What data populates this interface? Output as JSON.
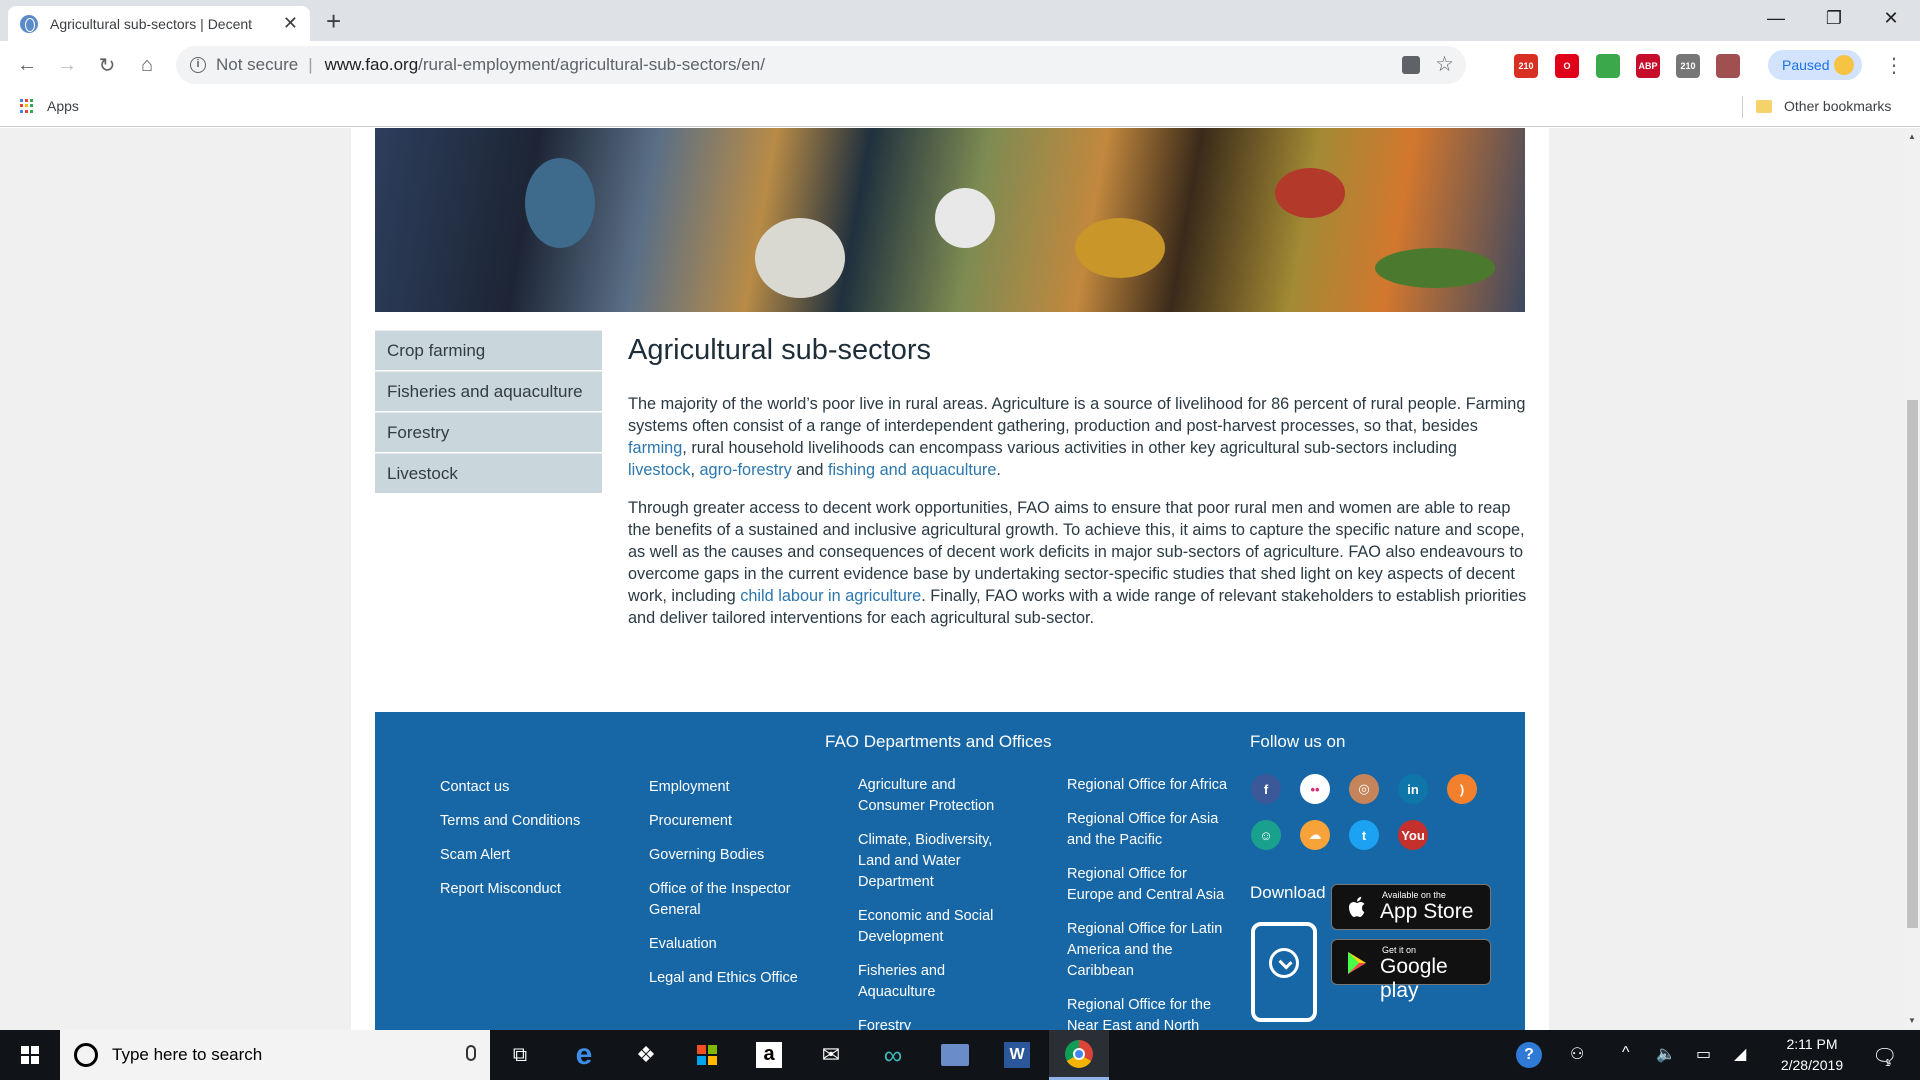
{
  "browser": {
    "tab_title": "Agricultural sub-sectors | Decent",
    "new_tab": "+",
    "security_label": "Not secure",
    "url_host": "www.fao.org",
    "url_path": "/rural-employment/agricultural-sub-sectors/en/",
    "profile_label": "Paused",
    "extensions": [
      {
        "name": "gmail-extension-icon",
        "text": "210",
        "color": "#d93025"
      },
      {
        "name": "opera-extension-icon",
        "text": "O",
        "color": "#e0001a"
      },
      {
        "name": "globe-extension-icon",
        "text": "",
        "color": "#3aa84b"
      },
      {
        "name": "adblock-extension-icon",
        "text": "ABP",
        "color": "#c70d2c"
      },
      {
        "name": "gmail-extension-icon-2",
        "text": "210",
        "color": "#777777"
      },
      {
        "name": "pdf-extension-icon",
        "text": "",
        "color": "#a05050"
      }
    ],
    "bookmarks": {
      "apps": "Apps",
      "other": "Other bookmarks"
    }
  },
  "sidenav": {
    "items": [
      "Crop farming",
      "Fisheries and aquaculture",
      "Forestry",
      "Livestock"
    ]
  },
  "content": {
    "title": "Agricultural sub-sectors",
    "p1_a": "The majority of the world’s poor live in rural areas. Agriculture is a source of livelihood for 86 percent of rural people. Farming systems often consist of a range of interdependent gathering, production and post-harvest processes, so that, besides ",
    "p1_link1": "farming",
    "p1_b": ", rural household livelihoods can encompass various activities in other key agricultural sub-sectors including ",
    "p1_link2": "livestock",
    "p1_c": ", ",
    "p1_link3": "agro-forestry",
    "p1_d": " and ",
    "p1_link4": "fishing and aquaculture",
    "p1_e": ".",
    "p2_a": "Through greater access to decent work opportunities, FAO aims to ensure that poor rural men and women are able to reap the benefits of a sustained and inclusive agricultural growth. To achieve this, it aims to capture the specific nature and scope, as well as the causes and consequences of decent work deficits in major sub-sectors of agriculture. FAO also endeavours to overcome gaps in the current evidence base by undertaking sector-specific studies that shed light on key aspects of decent work, including ",
    "p2_link": "child labour in agriculture",
    "p2_b": ". Finally, FAO works with a wide range of relevant stakeholders to establish priorities and deliver tailored interventions for each agricultural sub-sector."
  },
  "footer": {
    "dept_title": "FAO Departments and Offices",
    "col1": [
      "Contact us",
      "Terms and Conditions",
      "Scam Alert",
      "Report Misconduct"
    ],
    "col2": [
      "Employment",
      "Procurement",
      "Governing Bodies",
      "Office of the Inspector General",
      "Evaluation",
      "Legal and Ethics Office"
    ],
    "col3": [
      "Agriculture and Consumer Protection",
      "Climate, Biodiversity, Land and Water Department",
      "Economic and Social Development",
      "Fisheries and Aquaculture",
      "Forestry"
    ],
    "col4": [
      "Regional Office for Africa",
      "Regional Office for Asia and the Pacific",
      "Regional Office for Europe and Central Asia",
      "Regional Office for Latin America and the Caribbean",
      "Regional Office for the Near East and North"
    ],
    "follow_title": "Follow us on",
    "social": [
      {
        "name": "facebook-icon",
        "glyph": "f",
        "color": "#3b5998"
      },
      {
        "name": "flickr-icon",
        "glyph": "••",
        "color": "#ffffff"
      },
      {
        "name": "instagram-icon",
        "glyph": "◎",
        "color": "#c5845a"
      },
      {
        "name": "linkedin-icon",
        "glyph": "in",
        "color": "#0e76a8"
      },
      {
        "name": "rss-icon",
        "glyph": ")",
        "color": "#f2802d"
      },
      {
        "name": "slideshare-icon",
        "glyph": "☺",
        "color": "#1aa18d"
      },
      {
        "name": "soundcloud-icon",
        "glyph": "☁",
        "color": "#f7a33a"
      },
      {
        "name": "twitter-icon",
        "glyph": "t",
        "color": "#1da1f2"
      },
      {
        "name": "youtube-icon",
        "glyph": "You",
        "color": "#c4302b"
      }
    ],
    "app_title": "Download our App",
    "appstore_small": "Available on the",
    "appstore_big": "App Store",
    "googleplay_small": "Get it on",
    "googleplay_big": "Google play"
  },
  "taskbar": {
    "search_placeholder": "Type here to search",
    "time": "2:11 PM",
    "date": "2/28/2019",
    "notification_count": "1"
  }
}
